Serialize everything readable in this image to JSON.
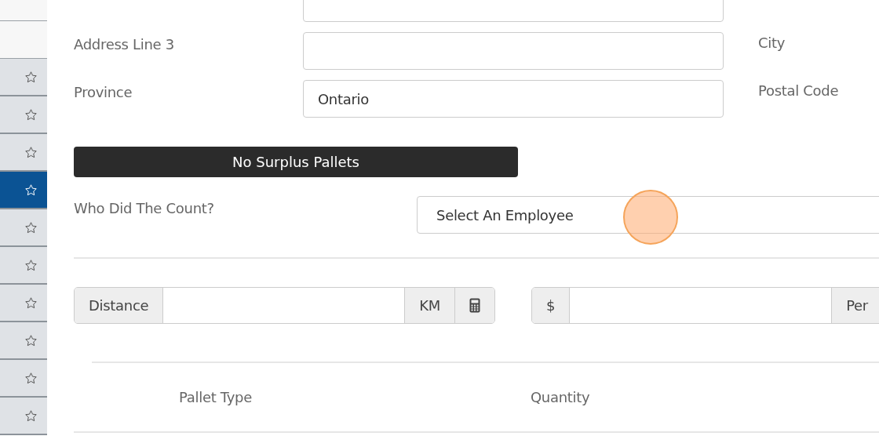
{
  "sidebar": {
    "items": [
      {
        "selected": false
      },
      {
        "selected": false
      },
      {
        "selected": false
      },
      {
        "selected": true
      },
      {
        "selected": false
      },
      {
        "selected": false
      },
      {
        "selected": false
      },
      {
        "selected": false
      },
      {
        "selected": false
      },
      {
        "selected": false
      }
    ]
  },
  "address_rows": [
    {
      "label": "Address Line 3",
      "right_label": "City"
    },
    {
      "label": "Province",
      "value": "Ontario",
      "right_label": "Postal Code"
    }
  ],
  "surplus_button": "No Surplus Pallets",
  "count": {
    "label": "Who Did The Count?",
    "value": "Select An Employee"
  },
  "distance_group": {
    "prefix": "Distance",
    "suffix": "KM"
  },
  "rate_group": {
    "prefix": "$",
    "suffix": "Per"
  },
  "table": {
    "columns": [
      "Pallet Type",
      "Quantity"
    ]
  }
}
